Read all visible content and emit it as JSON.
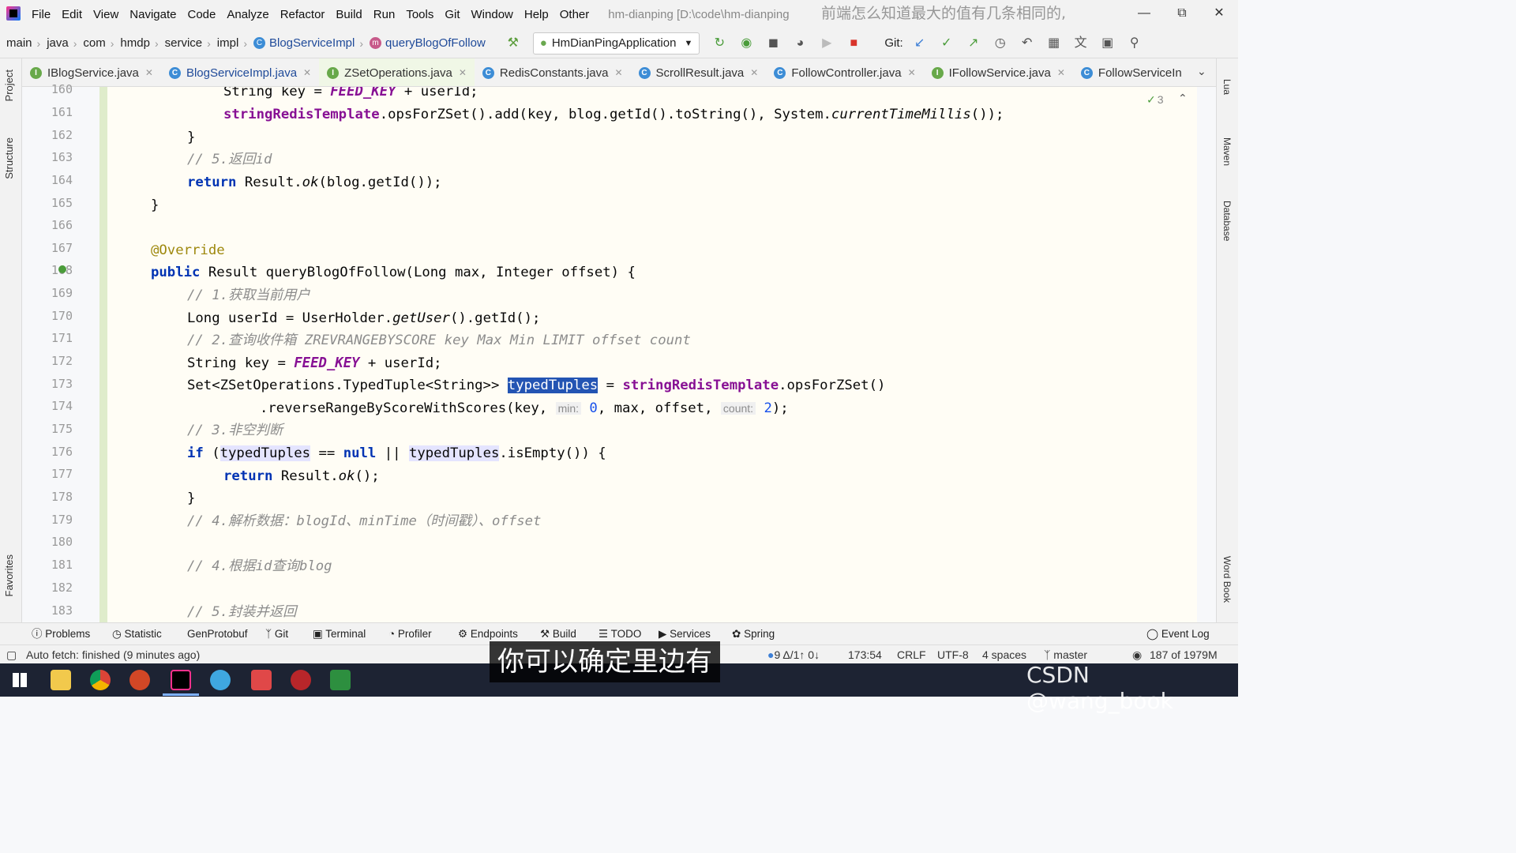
{
  "app": {
    "title": "hm-dianping [D:\\code\\hm-dianping",
    "overlay_text": "前端怎么知道最大的值有几条相同的,",
    "menu": [
      "File",
      "Edit",
      "View",
      "Navigate",
      "Code",
      "Analyze",
      "Refactor",
      "Build",
      "Run",
      "Tools",
      "Git",
      "Window",
      "Help",
      "Other"
    ]
  },
  "breadcrumb": [
    "main",
    "java",
    "com",
    "hmdp",
    "service",
    "impl",
    "BlogServiceImpl",
    "queryBlogOfFollow"
  ],
  "run_config": "HmDianPingApplication",
  "git_label": "Git:",
  "tabs": [
    {
      "label": "IBlogService.java",
      "kind": "I",
      "active": false
    },
    {
      "label": "BlogServiceImpl.java",
      "kind": "C",
      "active": true
    },
    {
      "label": "ZSetOperations.java",
      "kind": "I",
      "active": false
    },
    {
      "label": "RedisConstants.java",
      "kind": "C",
      "active": false
    },
    {
      "label": "ScrollResult.java",
      "kind": "C",
      "active": false
    },
    {
      "label": "FollowController.java",
      "kind": "C",
      "active": false
    },
    {
      "label": "IFollowService.java",
      "kind": "I",
      "active": false
    },
    {
      "label": "FollowServiceIn",
      "kind": "C",
      "active": false
    }
  ],
  "inspection_count": "3",
  "left_strip": [
    "Project",
    "Structure",
    "Favorites"
  ],
  "right_strip": [
    "Lua",
    "Maven",
    "Database",
    "Word Book"
  ],
  "line_numbers": [
    "160",
    "161",
    "162",
    "163",
    "164",
    "165",
    "166",
    "167",
    "168",
    "169",
    "170",
    "171",
    "172",
    "173",
    "174",
    "175",
    "176",
    "177",
    "178",
    "179",
    "180",
    "181",
    "182",
    "183"
  ],
  "code": {
    "l160": "String key = FEED_KEY + userId;",
    "l161": "stringRedisTemplate.opsForZSet().add(key, blog.getId().toString(), System.currentTimeMillis());",
    "l163": "// 5.返回id",
    "l164": "return Result.ok(blog.getId());",
    "l167": "@Override",
    "l168": "public Result queryBlogOfFollow(Long max, Integer offset) {",
    "l169": "// 1.获取当前用户",
    "l170": "Long userId = UserHolder.getUser().getId();",
    "l171": "// 2.查询收件箱 ZREVRANGEBYSCORE key Max Min LIMIT offset count",
    "l172": "String key = FEED_KEY + userId;",
    "l173a": "Set<ZSetOperations.TypedTuple<String>> ",
    "l173b": "typedTuples",
    "l173c": " = stringRedisTemplate.opsForZSet()",
    "l174": ".reverseRangeByScoreWithScores(key,",
    "l174_hint_min": "min:",
    "l174_min": "0",
    "l174_mid": ", max, offset,",
    "l174_hint_count": "count:",
    "l174_count": "2",
    "l174_end": ");",
    "l175": "// 3.非空判断",
    "l176": "if (typedTuples == null || typedTuples.isEmpty()) {",
    "l177": "return Result.ok();",
    "l179": "// 4.解析数据：blogId、minTime（时间戳）、offset",
    "l181": "// 4.根据id查询blog",
    "l183": "// 5.封装并返回"
  },
  "tool_windows": [
    "Problems",
    "Statistic",
    "GenProtobuf",
    "Git",
    "Terminal",
    "Profiler",
    "Endpoints",
    "Build",
    "TODO",
    "Services",
    "Spring",
    "Event Log"
  ],
  "status": {
    "message": "Auto fetch: finished (9 minutes ago)",
    "git_changes": "9 Δ/1↑ 0↓",
    "position": "173:54",
    "line_sep": "CRLF",
    "encoding": "UTF-8",
    "indent": "4 spaces",
    "branch": "master",
    "memory": "187 of 1979M"
  },
  "subtitle": "你可以确定里边有",
  "watermark": "CSDN @wang_book"
}
